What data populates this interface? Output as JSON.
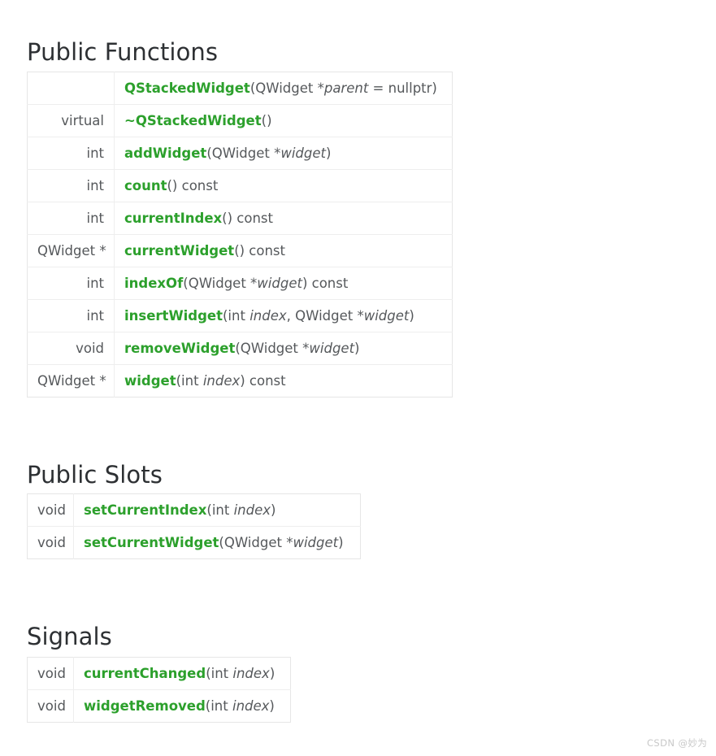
{
  "colors": {
    "function_name": "#2ca02c",
    "text": "#55585b",
    "heading": "#2d3033",
    "border": "#eeeeee",
    "background": "#ffffff",
    "watermark": "#c8c8c8"
  },
  "sections": [
    {
      "heading": "Public Functions",
      "rows": [
        {
          "return_type": "",
          "name": "QStackedWidget",
          "signature_after": "(QWidget *",
          "params": "parent",
          "signature_tail": " = nullptr)"
        },
        {
          "return_type": "virtual",
          "name": "~QStackedWidget",
          "signature_after": "()",
          "params": "",
          "signature_tail": ""
        },
        {
          "return_type": "int",
          "name": "addWidget",
          "signature_after": "(QWidget *",
          "params": "widget",
          "signature_tail": ")"
        },
        {
          "return_type": "int",
          "name": "count",
          "signature_after": "() const",
          "params": "",
          "signature_tail": ""
        },
        {
          "return_type": "int",
          "name": "currentIndex",
          "signature_after": "() const",
          "params": "",
          "signature_tail": ""
        },
        {
          "return_type": "QWidget *",
          "name": "currentWidget",
          "signature_after": "() const",
          "params": "",
          "signature_tail": ""
        },
        {
          "return_type": "int",
          "name": "indexOf",
          "signature_after": "(QWidget *",
          "params": "widget",
          "signature_tail": ") const"
        },
        {
          "return_type": "int",
          "name": "insertWidget",
          "signature_after": "(int ",
          "params": "index",
          "signature_tail": ", QWidget *",
          "params2": "widget",
          "signature_tail2": ")"
        },
        {
          "return_type": "void",
          "name": "removeWidget",
          "signature_after": "(QWidget *",
          "params": "widget",
          "signature_tail": ")"
        },
        {
          "return_type": "QWidget *",
          "name": "widget",
          "signature_after": "(int ",
          "params": "index",
          "signature_tail": ") const"
        }
      ]
    },
    {
      "heading": "Public Slots",
      "rows": [
        {
          "return_type": "void",
          "name": "setCurrentIndex",
          "signature_after": "(int ",
          "params": "index",
          "signature_tail": ")"
        },
        {
          "return_type": "void",
          "name": "setCurrentWidget",
          "signature_after": "(QWidget *",
          "params": "widget",
          "signature_tail": ")"
        }
      ]
    },
    {
      "heading": "Signals",
      "rows": [
        {
          "return_type": "void",
          "name": "currentChanged",
          "signature_after": "(int ",
          "params": "index",
          "signature_tail": ")"
        },
        {
          "return_type": "void",
          "name": "widgetRemoved",
          "signature_after": "(int ",
          "params": "index",
          "signature_tail": ")"
        }
      ]
    }
  ],
  "watermark": "CSDN @妙为"
}
